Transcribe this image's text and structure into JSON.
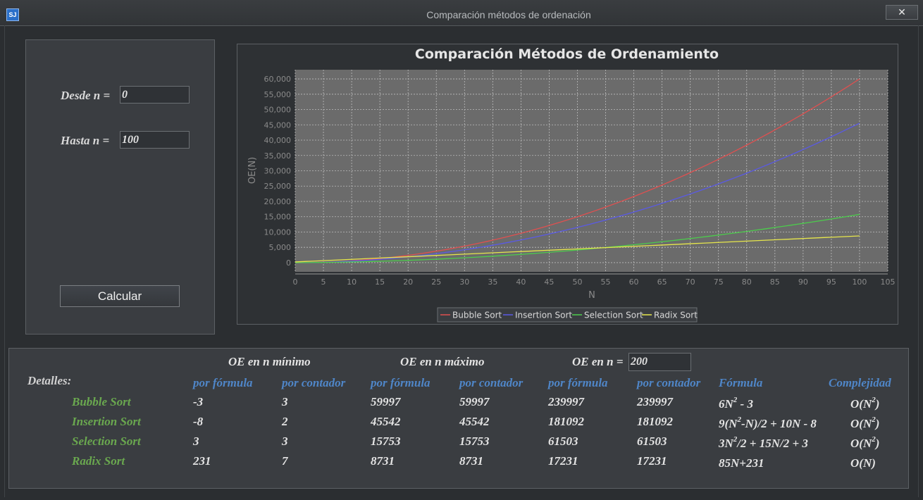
{
  "window": {
    "title": "Comparación métodos de ordenación",
    "close_label": "✕",
    "icon": "app-icon"
  },
  "inputs": {
    "desde_label": "Desde n =",
    "desde_value": "0",
    "hasta_label": "Hasta  n =",
    "hasta_value": "100",
    "calcular_label": "Calcular"
  },
  "chart_data": {
    "type": "line",
    "title": "Comparación Métodos de Ordenamiento",
    "xlabel": "N",
    "ylabel": "OE(N)",
    "xlim": [
      0,
      105
    ],
    "ylim": [
      -3000,
      63000
    ],
    "x_ticks": [
      0,
      5,
      10,
      15,
      20,
      25,
      30,
      35,
      40,
      45,
      50,
      55,
      60,
      65,
      70,
      75,
      80,
      85,
      90,
      95,
      100,
      105
    ],
    "y_ticks": [
      0,
      5000,
      10000,
      15000,
      20000,
      25000,
      30000,
      35000,
      40000,
      45000,
      50000,
      55000,
      60000
    ],
    "y_tick_labels": [
      "0",
      "5,000",
      "10,000",
      "15,000",
      "20,000",
      "25,000",
      "30,000",
      "35,000",
      "40,000",
      "45,000",
      "50,000",
      "55,000",
      "60,000"
    ],
    "grid": true,
    "legend_position": "bottom",
    "series": [
      {
        "name": "Bubble Sort",
        "color": "#e05050",
        "formula": "bubble"
      },
      {
        "name": "Insertion Sort",
        "color": "#5a5ae6",
        "formula": "insertion"
      },
      {
        "name": "Selection Sort",
        "color": "#4ccc4c",
        "formula": "selection"
      },
      {
        "name": "Radix Sort",
        "color": "#e6e64c",
        "formula": "radix"
      }
    ]
  },
  "details": {
    "label": "Detalles:",
    "group_min": "OE en n mínimo",
    "group_max": "OE en n máximo",
    "group_n": "OE en n =",
    "n_value": "200",
    "sub_formula": "por fórmula",
    "sub_counter": "por contador",
    "col_formula": "Fórmula",
    "col_complexity": "Complejidad",
    "rows": [
      {
        "name": "Bubble Sort",
        "min_f": "-3",
        "min_c": "3",
        "max_f": "59997",
        "max_c": "59997",
        "n_f": "239997",
        "n_c": "239997",
        "formula_pre": "6N",
        "formula_sup": "2",
        "formula_post": " - 3",
        "complexity_pre": "O(N",
        "complexity_sup": "2",
        "complexity_post": ")"
      },
      {
        "name": "Insertion Sort",
        "min_f": "-8",
        "min_c": "2",
        "max_f": "45542",
        "max_c": "45542",
        "n_f": "181092",
        "n_c": "181092",
        "formula_pre": "9(N",
        "formula_sup": "2",
        "formula_post": "-N)/2 + 10N - 8",
        "complexity_pre": "O(N",
        "complexity_sup": "2",
        "complexity_post": ")"
      },
      {
        "name": "Selection Sort",
        "min_f": "3",
        "min_c": "3",
        "max_f": "15753",
        "max_c": "15753",
        "n_f": "61503",
        "n_c": "61503",
        "formula_pre": "3N",
        "formula_sup": "2",
        "formula_post": "/2 + 15N/2 + 3",
        "complexity_pre": "O(N",
        "complexity_sup": "2",
        "complexity_post": ")"
      },
      {
        "name": "Radix Sort",
        "min_f": "231",
        "min_c": "7",
        "max_f": "8731",
        "max_c": "8731",
        "n_f": "17231",
        "n_c": "17231",
        "formula_pre": "85N+231",
        "formula_sup": "",
        "formula_post": "",
        "complexity_pre": "O(N)",
        "complexity_sup": "",
        "complexity_post": ""
      }
    ]
  }
}
